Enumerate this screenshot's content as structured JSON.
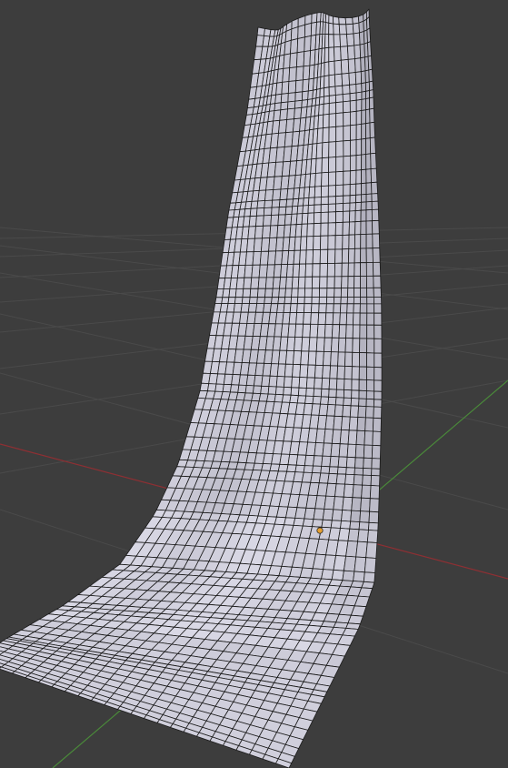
{
  "viewport": {
    "background_color": "#3d3d3d",
    "grid_color": "#4a4a4a",
    "x_axis_color": "#8e2f33",
    "y_axis_color": "#4a8a3a",
    "mesh": {
      "face_color": "#c8c7d2",
      "edge_color": "#1a1a1a",
      "columns": 24,
      "rows": 72,
      "description_icon": "cloth-mesh-object"
    },
    "object_origin": {
      "icon": "origin-point-icon",
      "color": "#e6a030"
    }
  }
}
